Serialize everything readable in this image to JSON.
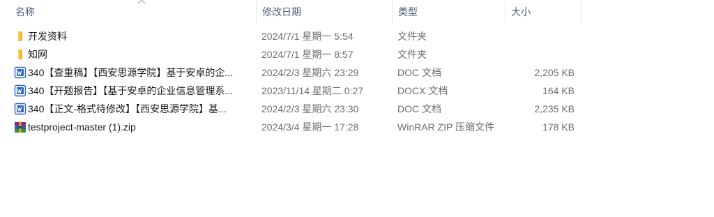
{
  "header": {
    "name": "名称",
    "date": "修改日期",
    "type": "类型",
    "size": "大小"
  },
  "files": [
    {
      "icon": "folder-icon",
      "name": "开发资料",
      "date": "2024/7/1 星期一 5:54",
      "type": "文件夹",
      "size": ""
    },
    {
      "icon": "folder-icon",
      "name": "知网",
      "date": "2024/7/1 星期一 8:57",
      "type": "文件夹",
      "size": ""
    },
    {
      "icon": "word-doc-icon",
      "name": "340【查重稿】【西安思源学院】基于安卓的企...",
      "date": "2024/2/3 星期六 23:29",
      "type": "DOC 文档",
      "size": "2,205 KB"
    },
    {
      "icon": "word-doc-icon",
      "name": "340【开题报告】【基于安卓的企业信息管理系...",
      "date": "2023/11/14 星期二 0:27",
      "type": "DOCX 文档",
      "size": "164 KB"
    },
    {
      "icon": "word-doc-icon",
      "name": "340【正文-格式待修改】【西安思源学院】基...",
      "date": "2024/2/3 星期六 23:30",
      "type": "DOC 文档",
      "size": "2,235 KB"
    },
    {
      "icon": "winrar-archive-icon",
      "name": "testproject-master (1).zip",
      "date": "2024/3/4 星期一 17:28",
      "type": "WinRAR ZIP 压缩文件",
      "size": "178 KB"
    }
  ]
}
